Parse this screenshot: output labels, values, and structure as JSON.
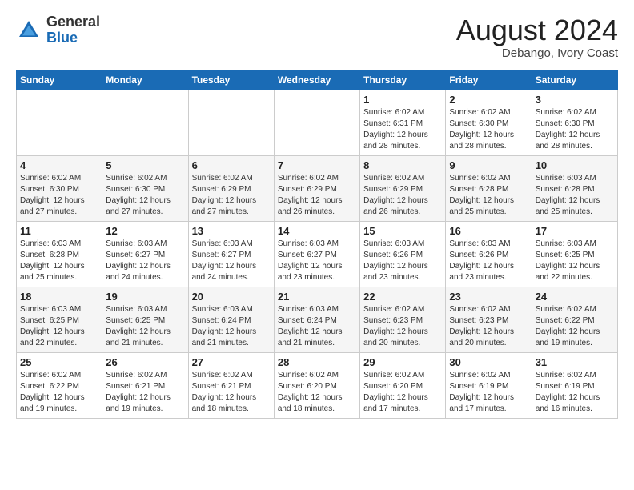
{
  "header": {
    "logo_general": "General",
    "logo_blue": "Blue",
    "month_title": "August 2024",
    "location": "Debango, Ivory Coast"
  },
  "days_of_week": [
    "Sunday",
    "Monday",
    "Tuesday",
    "Wednesday",
    "Thursday",
    "Friday",
    "Saturday"
  ],
  "weeks": [
    [
      {
        "day": "",
        "detail": ""
      },
      {
        "day": "",
        "detail": ""
      },
      {
        "day": "",
        "detail": ""
      },
      {
        "day": "",
        "detail": ""
      },
      {
        "day": "1",
        "detail": "Sunrise: 6:02 AM\nSunset: 6:31 PM\nDaylight: 12 hours\nand 28 minutes."
      },
      {
        "day": "2",
        "detail": "Sunrise: 6:02 AM\nSunset: 6:30 PM\nDaylight: 12 hours\nand 28 minutes."
      },
      {
        "day": "3",
        "detail": "Sunrise: 6:02 AM\nSunset: 6:30 PM\nDaylight: 12 hours\nand 28 minutes."
      }
    ],
    [
      {
        "day": "4",
        "detail": "Sunrise: 6:02 AM\nSunset: 6:30 PM\nDaylight: 12 hours\nand 27 minutes."
      },
      {
        "day": "5",
        "detail": "Sunrise: 6:02 AM\nSunset: 6:30 PM\nDaylight: 12 hours\nand 27 minutes."
      },
      {
        "day": "6",
        "detail": "Sunrise: 6:02 AM\nSunset: 6:29 PM\nDaylight: 12 hours\nand 27 minutes."
      },
      {
        "day": "7",
        "detail": "Sunrise: 6:02 AM\nSunset: 6:29 PM\nDaylight: 12 hours\nand 26 minutes."
      },
      {
        "day": "8",
        "detail": "Sunrise: 6:02 AM\nSunset: 6:29 PM\nDaylight: 12 hours\nand 26 minutes."
      },
      {
        "day": "9",
        "detail": "Sunrise: 6:02 AM\nSunset: 6:28 PM\nDaylight: 12 hours\nand 25 minutes."
      },
      {
        "day": "10",
        "detail": "Sunrise: 6:03 AM\nSunset: 6:28 PM\nDaylight: 12 hours\nand 25 minutes."
      }
    ],
    [
      {
        "day": "11",
        "detail": "Sunrise: 6:03 AM\nSunset: 6:28 PM\nDaylight: 12 hours\nand 25 minutes."
      },
      {
        "day": "12",
        "detail": "Sunrise: 6:03 AM\nSunset: 6:27 PM\nDaylight: 12 hours\nand 24 minutes."
      },
      {
        "day": "13",
        "detail": "Sunrise: 6:03 AM\nSunset: 6:27 PM\nDaylight: 12 hours\nand 24 minutes."
      },
      {
        "day": "14",
        "detail": "Sunrise: 6:03 AM\nSunset: 6:27 PM\nDaylight: 12 hours\nand 23 minutes."
      },
      {
        "day": "15",
        "detail": "Sunrise: 6:03 AM\nSunset: 6:26 PM\nDaylight: 12 hours\nand 23 minutes."
      },
      {
        "day": "16",
        "detail": "Sunrise: 6:03 AM\nSunset: 6:26 PM\nDaylight: 12 hours\nand 23 minutes."
      },
      {
        "day": "17",
        "detail": "Sunrise: 6:03 AM\nSunset: 6:25 PM\nDaylight: 12 hours\nand 22 minutes."
      }
    ],
    [
      {
        "day": "18",
        "detail": "Sunrise: 6:03 AM\nSunset: 6:25 PM\nDaylight: 12 hours\nand 22 minutes."
      },
      {
        "day": "19",
        "detail": "Sunrise: 6:03 AM\nSunset: 6:25 PM\nDaylight: 12 hours\nand 21 minutes."
      },
      {
        "day": "20",
        "detail": "Sunrise: 6:03 AM\nSunset: 6:24 PM\nDaylight: 12 hours\nand 21 minutes."
      },
      {
        "day": "21",
        "detail": "Sunrise: 6:03 AM\nSunset: 6:24 PM\nDaylight: 12 hours\nand 21 minutes."
      },
      {
        "day": "22",
        "detail": "Sunrise: 6:02 AM\nSunset: 6:23 PM\nDaylight: 12 hours\nand 20 minutes."
      },
      {
        "day": "23",
        "detail": "Sunrise: 6:02 AM\nSunset: 6:23 PM\nDaylight: 12 hours\nand 20 minutes."
      },
      {
        "day": "24",
        "detail": "Sunrise: 6:02 AM\nSunset: 6:22 PM\nDaylight: 12 hours\nand 19 minutes."
      }
    ],
    [
      {
        "day": "25",
        "detail": "Sunrise: 6:02 AM\nSunset: 6:22 PM\nDaylight: 12 hours\nand 19 minutes."
      },
      {
        "day": "26",
        "detail": "Sunrise: 6:02 AM\nSunset: 6:21 PM\nDaylight: 12 hours\nand 19 minutes."
      },
      {
        "day": "27",
        "detail": "Sunrise: 6:02 AM\nSunset: 6:21 PM\nDaylight: 12 hours\nand 18 minutes."
      },
      {
        "day": "28",
        "detail": "Sunrise: 6:02 AM\nSunset: 6:20 PM\nDaylight: 12 hours\nand 18 minutes."
      },
      {
        "day": "29",
        "detail": "Sunrise: 6:02 AM\nSunset: 6:20 PM\nDaylight: 12 hours\nand 17 minutes."
      },
      {
        "day": "30",
        "detail": "Sunrise: 6:02 AM\nSunset: 6:19 PM\nDaylight: 12 hours\nand 17 minutes."
      },
      {
        "day": "31",
        "detail": "Sunrise: 6:02 AM\nSunset: 6:19 PM\nDaylight: 12 hours\nand 16 minutes."
      }
    ]
  ]
}
